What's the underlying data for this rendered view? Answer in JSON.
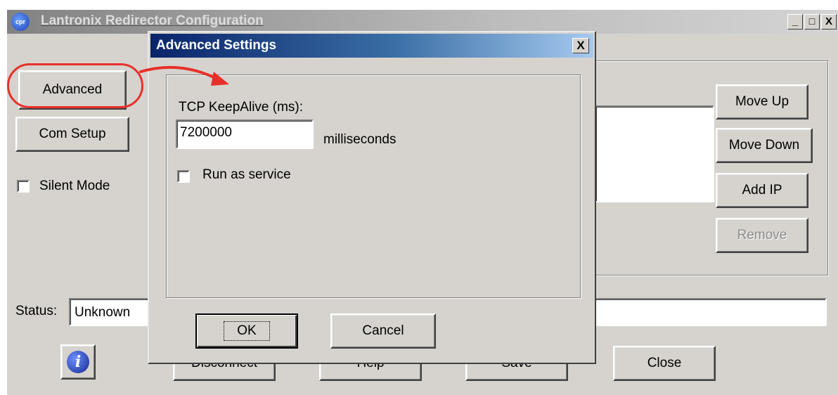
{
  "main_window": {
    "title": "Lantronix Redirector Configuration",
    "icon_text": "cpr",
    "caption_buttons": {
      "minimize": "_",
      "maximize": "□",
      "close": "X"
    },
    "buttons": {
      "advanced": "Advanced",
      "com_setup": "Com Setup",
      "move_up": "Move Up",
      "move_down": "Move Down",
      "add_ip": "Add IP",
      "remove": "Remove",
      "disconnect": "Disconnect",
      "help": "Help",
      "save": "Save",
      "close": "Close"
    },
    "silent_mode_label": "Silent Mode",
    "silent_mode_checked": false,
    "status_label": "Status:",
    "status_value": "Unknown",
    "info_icon": "i"
  },
  "dialog": {
    "title": "Advanced Settings",
    "close_glyph": "X",
    "keepalive_label": "TCP KeepAlive (ms):",
    "keepalive_value": "7200000",
    "keepalive_unit": "milliseconds",
    "run_as_service_label": "Run as service",
    "run_as_service_checked": false,
    "ok_label": "OK",
    "cancel_label": "Cancel"
  },
  "annotation": {
    "color": "#e8302a"
  }
}
